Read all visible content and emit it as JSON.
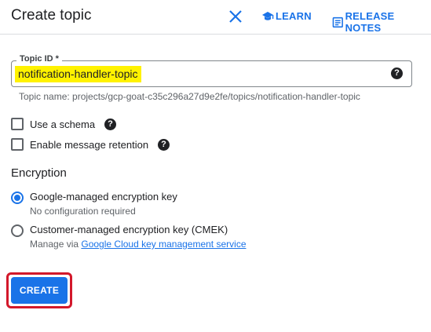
{
  "header": {
    "title": "Create topic",
    "learn_label": "LEARN",
    "release_notes_label": "RELEASE NOTES"
  },
  "topic_id": {
    "label": "Topic ID *",
    "value": "notification-handler-topic",
    "help_glyph": "?",
    "topic_name": "Topic name: projects/gcp-goat-c35c296a27d9e2fe/topics/notification-handler-topic"
  },
  "options": {
    "schema_label": "Use a schema",
    "retention_label": "Enable message retention",
    "help_glyph": "?"
  },
  "encryption": {
    "title": "Encryption",
    "google_label": "Google-managed encryption key",
    "google_sub": "No configuration required",
    "cmek_label": "Customer-managed encryption key (CMEK)",
    "cmek_sub_prefix": "Manage via ",
    "cmek_link": "Google Cloud key management service",
    "selected": "google"
  },
  "actions": {
    "create_label": "CREATE"
  },
  "colors": {
    "accent": "#1a73e8",
    "highlight": "#fff200",
    "outline": "#d3182b"
  },
  "icons": {
    "close": "close-icon",
    "learn": "school-icon",
    "release_notes": "release-notes-icon",
    "help": "help-icon"
  }
}
